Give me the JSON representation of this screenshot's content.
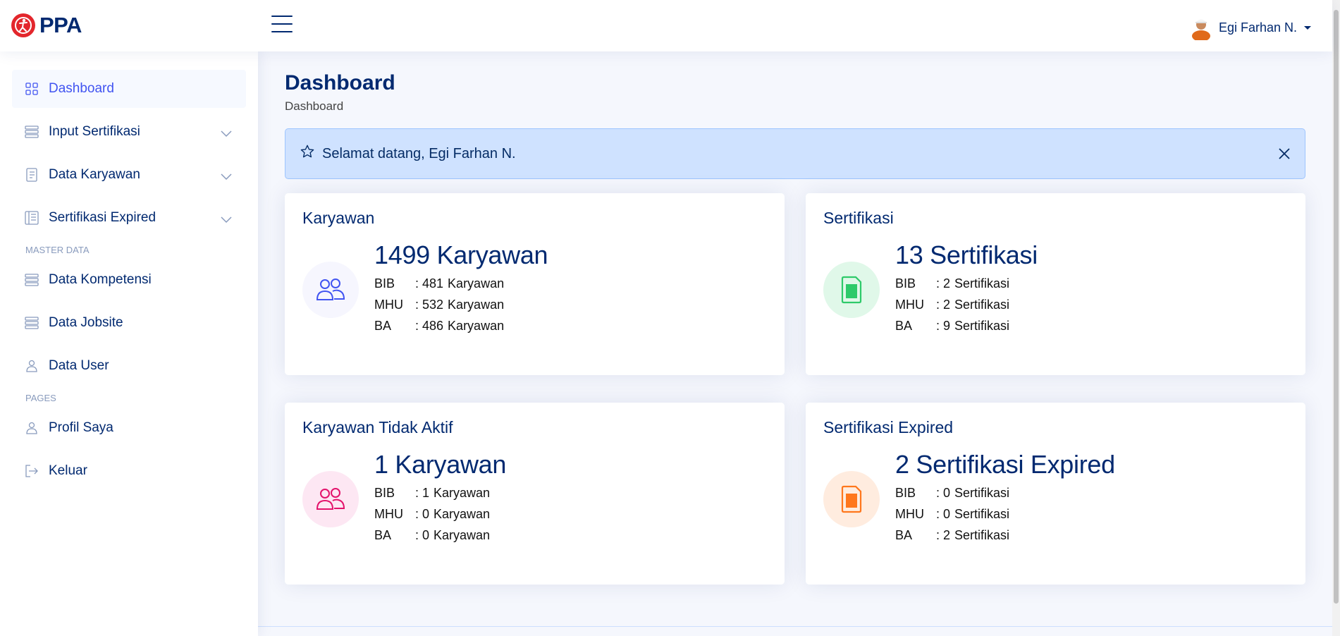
{
  "brand": {
    "name": "PPA"
  },
  "header": {
    "user_name": "Egi Farhan N."
  },
  "sidebar": {
    "items": [
      {
        "label": "Dashboard",
        "icon": "grid-icon"
      },
      {
        "label": "Input Sertifikasi",
        "icon": "menu-icon"
      },
      {
        "label": "Data Karyawan",
        "icon": "journal-text-icon"
      },
      {
        "label": "Sertifikasi Expired",
        "icon": "layout-text-icon"
      }
    ],
    "master_heading": "MASTER DATA",
    "master_items": [
      {
        "label": "Data Kompetensi"
      },
      {
        "label": "Data Jobsite"
      },
      {
        "label": "Data User"
      }
    ],
    "pages_heading": "PAGES",
    "pages_items": [
      {
        "label": "Profil Saya"
      },
      {
        "label": "Keluar"
      }
    ]
  },
  "main": {
    "title": "Dashboard",
    "breadcrumb": "Dashboard",
    "alert": "Selamat datang, Egi Farhan N.",
    "colors": {
      "accent": "#4154f1",
      "green": "#2eca6a",
      "pink": "#e3126b",
      "orange": "#ff771d"
    },
    "cards": [
      {
        "title": "Karyawan",
        "total": "1499 Karyawan",
        "rows": [
          {
            "k": "BIB",
            "v": "481",
            "u": "Karyawan"
          },
          {
            "k": "MHU",
            "v": "532",
            "u": "Karyawan"
          },
          {
            "k": "BA",
            "v": "486",
            "u": "Karyawan"
          }
        ]
      },
      {
        "title": "Sertifikasi",
        "total": "13 Sertifikasi",
        "rows": [
          {
            "k": "BIB",
            "v": "2",
            "u": "Sertifikasi"
          },
          {
            "k": "MHU",
            "v": "2",
            "u": "Sertifikasi"
          },
          {
            "k": "BA",
            "v": "9",
            "u": "Sertifikasi"
          }
        ]
      },
      {
        "title": "Karyawan Tidak Aktif",
        "total": "1 Karyawan",
        "rows": [
          {
            "k": "BIB",
            "v": "1",
            "u": "Karyawan"
          },
          {
            "k": "MHU",
            "v": "0",
            "u": "Karyawan"
          },
          {
            "k": "BA",
            "v": "0",
            "u": "Karyawan"
          }
        ]
      },
      {
        "title": "Sertifikasi Expired",
        "total": "2 Sertifikasi Expired",
        "rows": [
          {
            "k": "BIB",
            "v": "0",
            "u": "Sertifikasi"
          },
          {
            "k": "MHU",
            "v": "0",
            "u": "Sertifikasi"
          },
          {
            "k": "BA",
            "v": "2",
            "u": "Sertifikasi"
          }
        ]
      }
    ]
  }
}
